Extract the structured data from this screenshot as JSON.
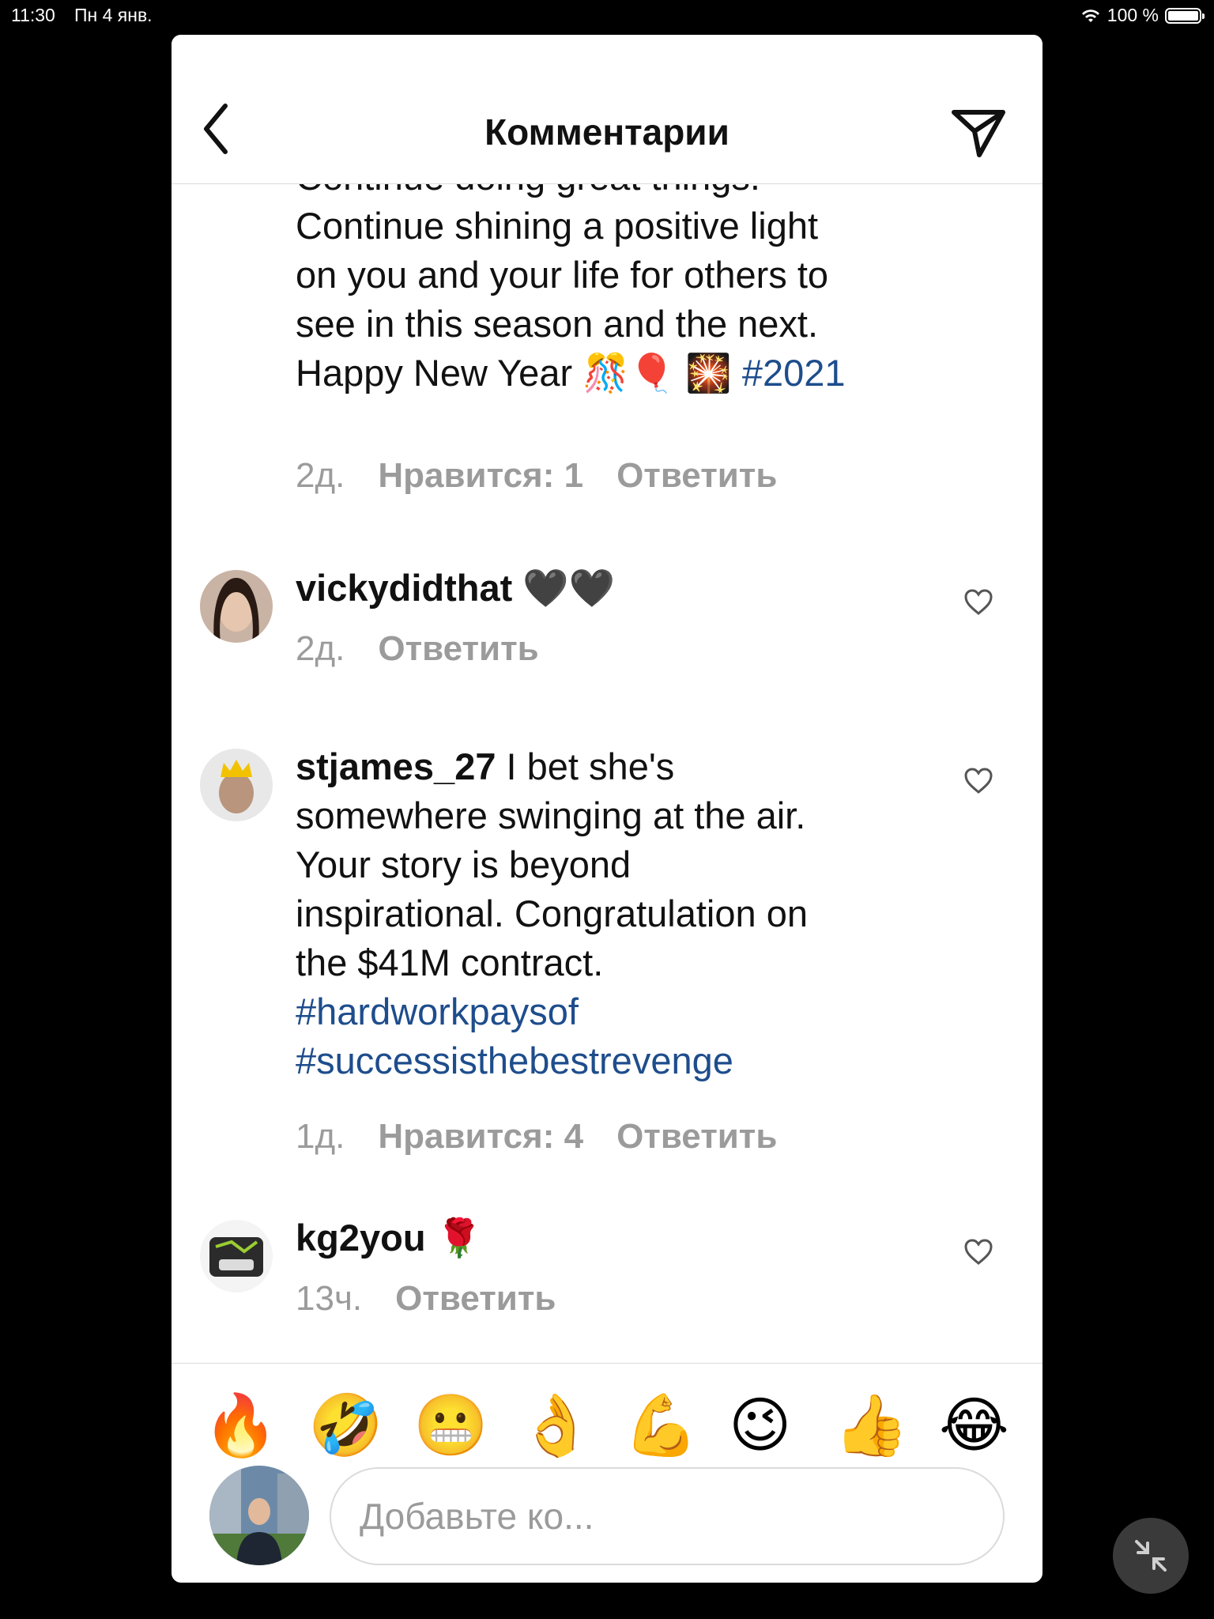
{
  "status_bar": {
    "time": "11:30",
    "date": "Пн 4 янв.",
    "battery": "100 %"
  },
  "header": {
    "title": "Комментарии"
  },
  "comments": [
    {
      "partial_line": "Continue doing great things.",
      "lines": [
        "Continue shining a positive light",
        "on you and your life for others to",
        "see in this season and the next.",
        "Happy New Year 🎊🎈 🎇 "
      ],
      "hashtag": "#2021",
      "time": "2д.",
      "likes": "Нравится: 1",
      "reply": "Ответить"
    },
    {
      "username": "vickydidthat",
      "text": " 🖤🖤",
      "time": "2д.",
      "reply": "Ответить"
    },
    {
      "username": "stjames_27",
      "text_first": " I bet she's",
      "lines": [
        "somewhere swinging at the air.",
        "Your story is beyond",
        "inspirational. Congratulation on",
        "the $41M contract."
      ],
      "hashtags": [
        "#hardworkpaysof",
        "#successisthebestrevenge"
      ],
      "time": "1д.",
      "likes": "Нравится: 4",
      "reply": "Ответить"
    },
    {
      "username": "kg2you",
      "text": " 🌹",
      "time": "13ч.",
      "reply": "Ответить"
    }
  ],
  "emoji_bar": [
    "🔥",
    "🤣",
    "😬",
    "👌",
    "💪",
    "😉",
    "👍",
    "😂"
  ],
  "input": {
    "placeholder": "Добавьте ко..."
  },
  "colors": {
    "hashtag": "#1e4d8c",
    "meta": "#9b9b9b",
    "divider": "#dbdbdb"
  }
}
